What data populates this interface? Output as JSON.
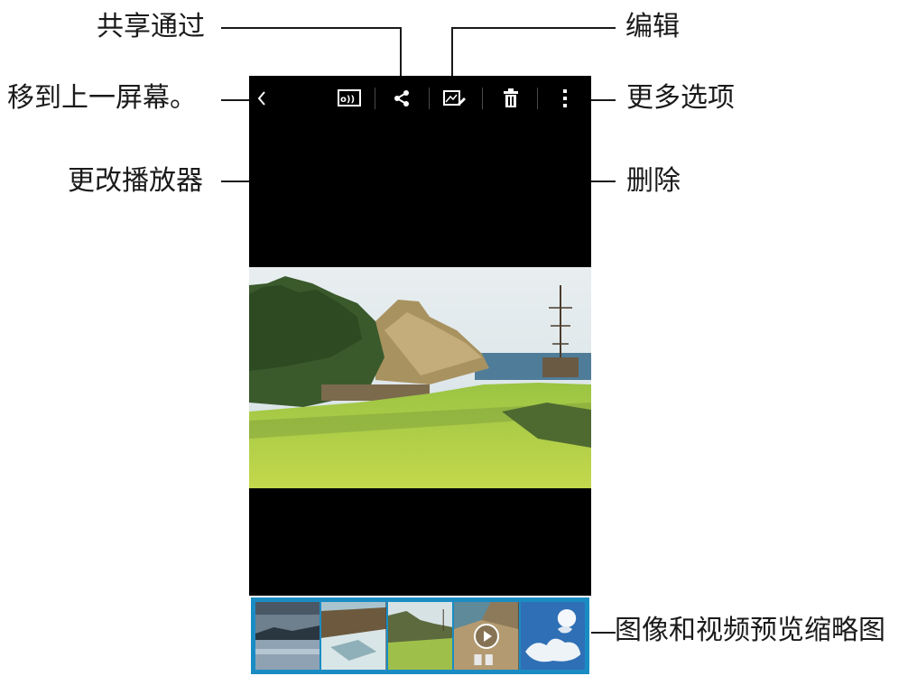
{
  "callouts": {
    "share_via": "共享通过",
    "edit": "编辑",
    "back": "移到上一屏幕。",
    "more_options": "更多选项",
    "change_player": "更改播放器",
    "delete": "删除",
    "thumbnails": "图像和视频预览缩略图"
  },
  "toolbar": {
    "back_icon": "chevron-left-icon",
    "player_icon": "change-player-icon",
    "share_icon": "share-icon",
    "edit_icon": "edit-icon",
    "delete_icon": "trash-icon",
    "more_icon": "more-options-icon"
  },
  "thumbnails": [
    {
      "name": "lake-thumbnail"
    },
    {
      "name": "coast-thumbnail"
    },
    {
      "name": "field-thumbnail"
    },
    {
      "name": "video-thumbnail"
    },
    {
      "name": "sky-thumbnail"
    }
  ],
  "colors": {
    "accent": "#1a8cc4",
    "screen_bg": "#000000"
  }
}
